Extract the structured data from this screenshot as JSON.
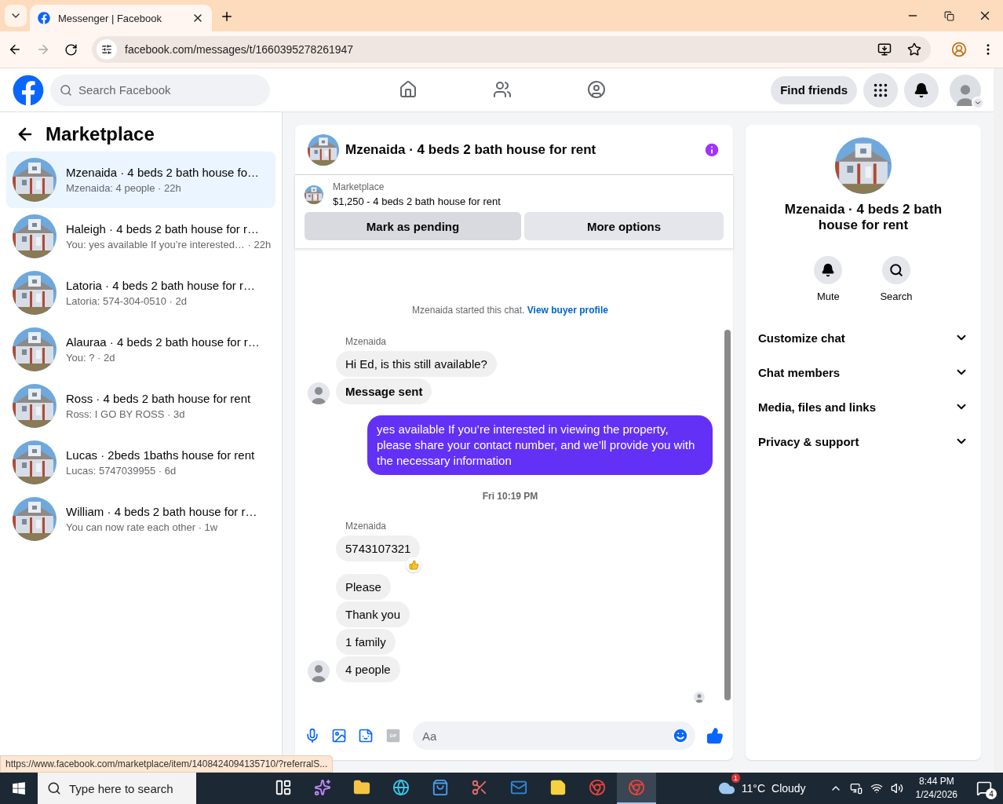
{
  "browser": {
    "tab": {
      "title": "Messenger | Facebook",
      "selected": true
    },
    "url": "facebook.com/messages/t/1660395278261947"
  },
  "topbar": {
    "search": {
      "placeholder": "Search Facebook"
    },
    "nav": [
      {
        "kind": "home",
        "selected": false
      },
      {
        "kind": "friends",
        "selected": false
      },
      {
        "kind": "groups",
        "selected": false
      }
    ],
    "find_friends": "Find friends"
  },
  "sidebar": {
    "title": "Marketplace",
    "conversations": [
      {
        "title": "Mzenaida · 4 beds 2 bath house fo…",
        "preview": "Mzenaida: 4 people · 22h",
        "selected": true
      },
      {
        "title": "Haleigh · 4 beds 2 bath house for r…",
        "preview": "You: yes available If you’re interested… · 22h",
        "selected": false
      },
      {
        "title": "Latoria · 4 beds 2 bath house for r…",
        "preview": "Latoria: 574-304-0510 · 2d",
        "selected": false
      },
      {
        "title": "Alauraa · 4 beds 2 bath house for r…",
        "preview": "You: ? · 2d",
        "selected": false
      },
      {
        "title": "Ross · 4 beds 2 bath house for rent",
        "preview": "Ross: I GO BY ROSS · 3d",
        "selected": false
      },
      {
        "title": "Lucas · 2beds 1baths house for rent",
        "preview": "Lucas: 5747039955 · 6d",
        "selected": false
      },
      {
        "title": "William · 4 beds 2 bath house for r…",
        "preview": "You can now rate each other · 1w",
        "selected": false
      }
    ]
  },
  "chat": {
    "title": "Mzenaida · 4 beds 2 bath house for rent",
    "listing": {
      "label": "Marketplace",
      "text": "$1,250 - 4 beds 2 bath house for rent"
    },
    "actions": [
      "Mark as pending",
      "More options"
    ],
    "messages": [
      {
        "kind": "notice",
        "text": "Mzenaida started this chat.",
        "link": "View buyer profile"
      },
      {
        "kind": "sender",
        "text": "Mzenaida"
      },
      {
        "kind": "incoming",
        "text": "Hi Ed, is this still available?",
        "bold": false,
        "avatar": false,
        "reaction": false
      },
      {
        "kind": "incoming",
        "text": "Message sent",
        "bold": true,
        "avatar": true,
        "reaction": false
      },
      {
        "kind": "outgoing",
        "text": "yes available  If you’re interested in viewing the property, please share your contact number, and we’ll provide you with the necessary information"
      },
      {
        "kind": "time",
        "text": "Fri 10:19 PM"
      },
      {
        "kind": "sender",
        "text": "Mzenaida"
      },
      {
        "kind": "incoming",
        "text": "5743107321",
        "bold": false,
        "avatar": false,
        "reaction": true
      },
      {
        "kind": "incoming",
        "text": "Please",
        "bold": false,
        "avatar": false,
        "reaction": false
      },
      {
        "kind": "incoming",
        "text": "Thank you",
        "bold": false,
        "avatar": false,
        "reaction": false
      },
      {
        "kind": "incoming",
        "text": "1 family",
        "bold": false,
        "avatar": false,
        "reaction": false
      },
      {
        "kind": "incoming",
        "text": "4 people",
        "bold": false,
        "avatar": true,
        "reaction": false
      },
      {
        "kind": "seen"
      }
    ],
    "composer": {
      "placeholder": "Aa"
    }
  },
  "info_panel": {
    "title": "Mzenaida · 4 beds 2 bath house for rent",
    "actions": [
      {
        "kind": "mute",
        "label": "Mute"
      },
      {
        "kind": "search",
        "label": "Search"
      }
    ],
    "sections": [
      {
        "label": "Customize chat",
        "expanded": false
      },
      {
        "label": "Chat members",
        "expanded": false
      },
      {
        "label": "Media, files and links",
        "expanded": false
      },
      {
        "label": "Privacy & support",
        "expanded": false
      }
    ]
  },
  "status_url": "https://www.facebook.com/marketplace/item/1408424094135710/?referralS...",
  "taskbar": {
    "search": {
      "placeholder": "Type here to search"
    },
    "apps": [
      {
        "kind": "taskview",
        "selected": false
      },
      {
        "kind": "copilot",
        "selected": false
      },
      {
        "kind": "files",
        "selected": false
      },
      {
        "kind": "edge",
        "selected": false
      },
      {
        "kind": "store",
        "selected": false
      },
      {
        "kind": "snip",
        "selected": false
      },
      {
        "kind": "outlook",
        "selected": false
      },
      {
        "kind": "notes",
        "selected": false
      },
      {
        "kind": "chrome",
        "selected": false
      },
      {
        "kind": "chrome",
        "selected": true
      }
    ],
    "weather": {
      "badge": "1",
      "temp": "11°C",
      "condition": "Cloudy"
    },
    "time": "8:44 PM",
    "date": "1/24/2026",
    "notifications": "4"
  }
}
